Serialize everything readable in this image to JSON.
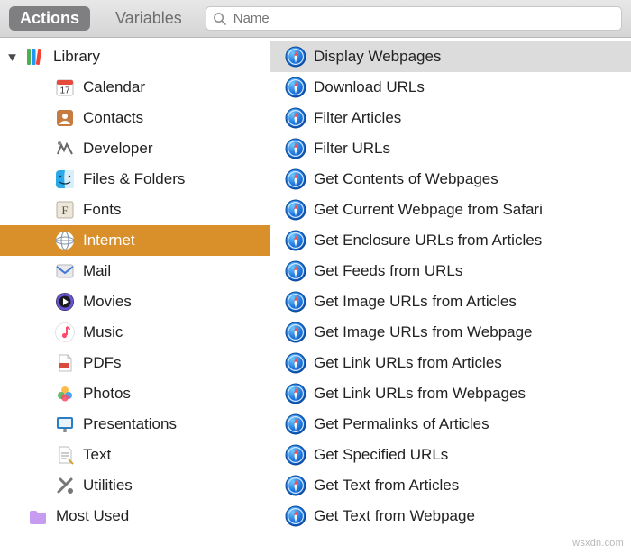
{
  "toolbar": {
    "tabs": {
      "actions": "Actions",
      "variables": "Variables"
    },
    "search_placeholder": "Name"
  },
  "sidebar": {
    "library_label": "Library",
    "categories": [
      {
        "id": "calendar",
        "label": "Calendar"
      },
      {
        "id": "contacts",
        "label": "Contacts"
      },
      {
        "id": "developer",
        "label": "Developer"
      },
      {
        "id": "files",
        "label": "Files & Folders"
      },
      {
        "id": "fonts",
        "label": "Fonts"
      },
      {
        "id": "internet",
        "label": "Internet"
      },
      {
        "id": "mail",
        "label": "Mail"
      },
      {
        "id": "movies",
        "label": "Movies"
      },
      {
        "id": "music",
        "label": "Music"
      },
      {
        "id": "pdfs",
        "label": "PDFs"
      },
      {
        "id": "photos",
        "label": "Photos"
      },
      {
        "id": "presentations",
        "label": "Presentations"
      },
      {
        "id": "text",
        "label": "Text"
      },
      {
        "id": "utilities",
        "label": "Utilities"
      }
    ],
    "most_used_label": "Most Used"
  },
  "actions": [
    "Display Webpages",
    "Download URLs",
    "Filter Articles",
    "Filter URLs",
    "Get Contents of Webpages",
    "Get Current Webpage from Safari",
    "Get Enclosure URLs from Articles",
    "Get Feeds from URLs",
    "Get Image URLs from Articles",
    "Get Image URLs from Webpage",
    "Get Link URLs from Articles",
    "Get Link URLs from Webpages",
    "Get Permalinks of Articles",
    "Get Specified URLs",
    "Get Text from Articles",
    "Get Text from Webpage"
  ],
  "watermark": "wsxdn.com"
}
